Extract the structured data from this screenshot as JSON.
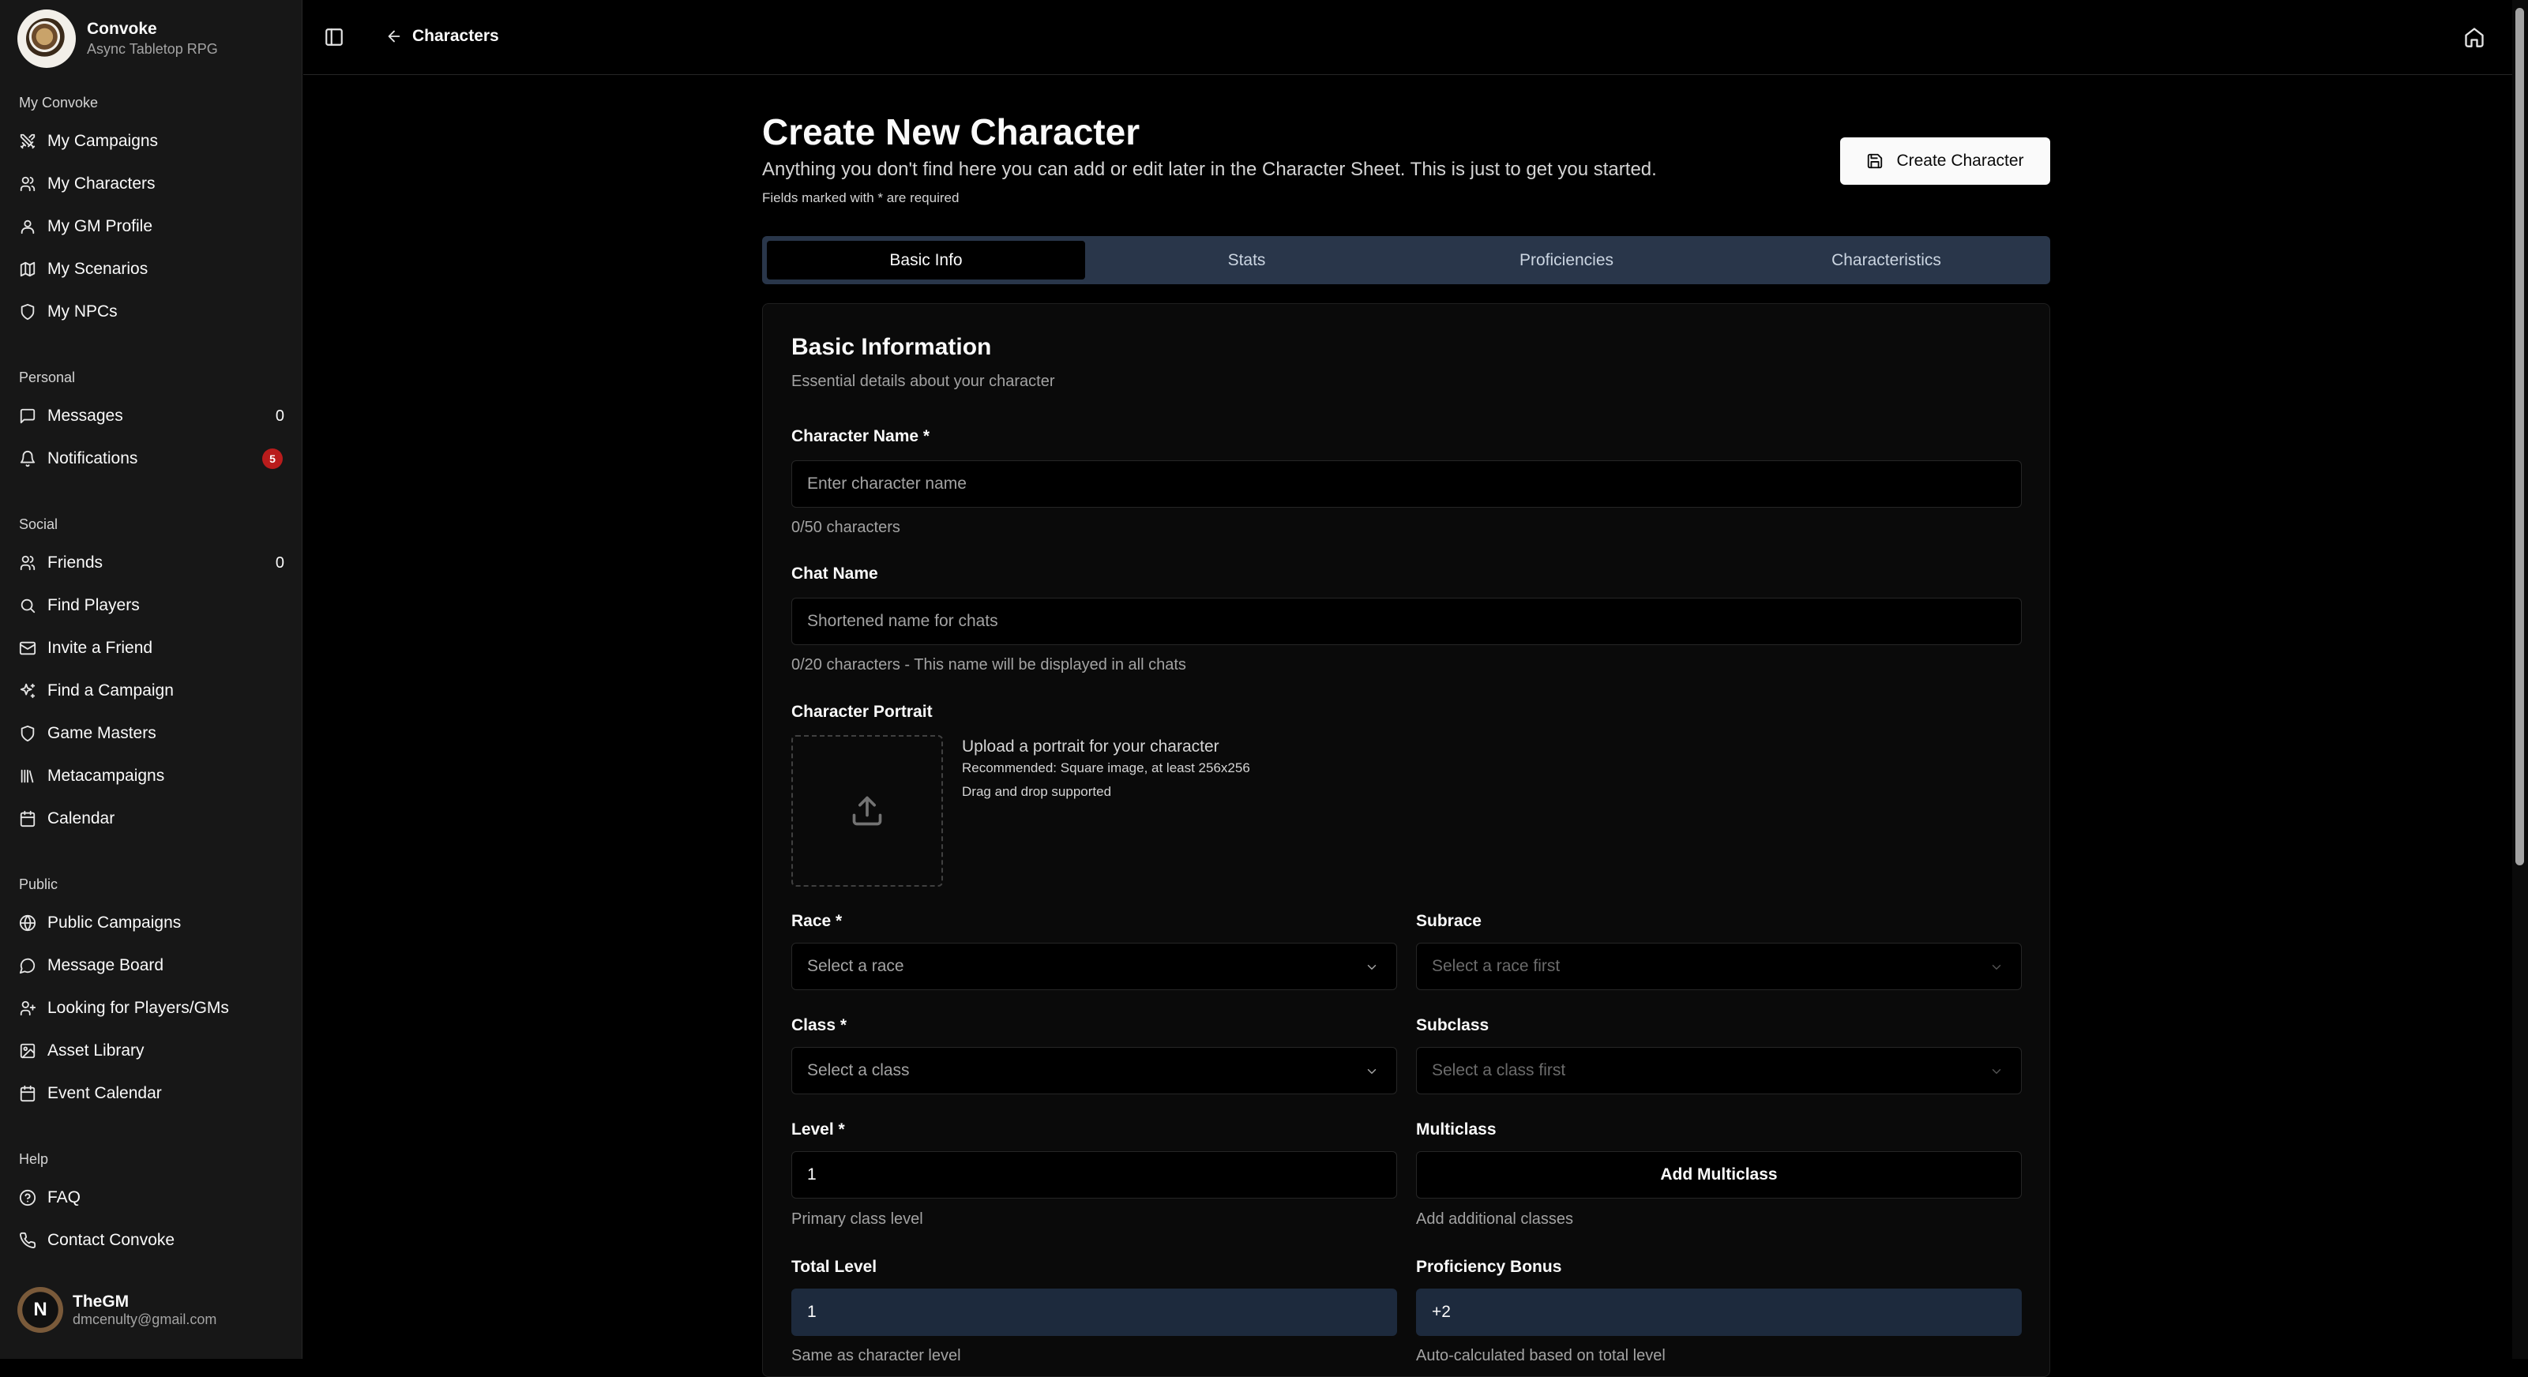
{
  "app": {
    "name": "Convoke",
    "tagline": "Async Tabletop RPG"
  },
  "sidebar": {
    "groups": [
      {
        "label": "My Convoke",
        "items": [
          {
            "label": "My Campaigns",
            "icon": "swords-icon"
          },
          {
            "label": "My Characters",
            "icon": "users-icon"
          },
          {
            "label": "My GM Profile",
            "icon": "user-icon"
          },
          {
            "label": "My Scenarios",
            "icon": "map-icon"
          },
          {
            "label": "My NPCs",
            "icon": "shield-icon"
          }
        ]
      },
      {
        "label": "Personal",
        "items": [
          {
            "label": "Messages",
            "icon": "message-icon",
            "count": "0"
          },
          {
            "label": "Notifications",
            "icon": "bell-icon",
            "badge": "5"
          }
        ]
      },
      {
        "label": "Social",
        "items": [
          {
            "label": "Friends",
            "icon": "users-icon",
            "count": "0"
          },
          {
            "label": "Find Players",
            "icon": "search-icon"
          },
          {
            "label": "Invite a Friend",
            "icon": "mail-icon"
          },
          {
            "label": "Find a Campaign",
            "icon": "sparkles-icon"
          },
          {
            "label": "Game Masters",
            "icon": "shield-icon"
          },
          {
            "label": "Metacampaigns",
            "icon": "library-icon"
          },
          {
            "label": "Calendar",
            "icon": "calendar-icon"
          }
        ]
      },
      {
        "label": "Public",
        "items": [
          {
            "label": "Public Campaigns",
            "icon": "globe-icon"
          },
          {
            "label": "Message Board",
            "icon": "message-icon"
          },
          {
            "label": "Looking for Players/GMs",
            "icon": "user-plus-icon"
          },
          {
            "label": "Asset Library",
            "icon": "image-icon"
          },
          {
            "label": "Event Calendar",
            "icon": "calendar-icon"
          }
        ]
      },
      {
        "label": "Help",
        "items": [
          {
            "label": "FAQ",
            "icon": "help-circle-icon"
          },
          {
            "label": "Contact Convoke",
            "icon": "phone-icon"
          }
        ]
      }
    ],
    "user": {
      "name": "TheGM",
      "email": "dmcenulty@gmail.com",
      "initial": "N"
    }
  },
  "header": {
    "back_label": "Characters"
  },
  "page": {
    "title": "Create New Character",
    "subtitle": "Anything you don't find here you can add or edit later in the Character Sheet. This is just to get you started.",
    "required_note": "Fields marked with * are required",
    "create_button": "Create Character"
  },
  "tabs": [
    {
      "label": "Basic Info",
      "active": true
    },
    {
      "label": "Stats",
      "active": false
    },
    {
      "label": "Proficiencies",
      "active": false
    },
    {
      "label": "Characteristics",
      "active": false
    }
  ],
  "form": {
    "title": "Basic Information",
    "description": "Essential details about your character",
    "character_name": {
      "label": "Character Name *",
      "placeholder": "Enter character name",
      "helper": "0/50 characters"
    },
    "chat_name": {
      "label": "Chat Name",
      "placeholder": "Shortened name for chats",
      "helper": "0/20 characters - This name will be displayed in all chats"
    },
    "portrait": {
      "label": "Character Portrait",
      "title": "Upload a portrait for your character",
      "recommendation": "Recommended: Square image, at least 256x256",
      "drag_note": "Drag and drop supported"
    },
    "race": {
      "label": "Race *",
      "placeholder": "Select a race"
    },
    "subrace": {
      "label": "Subrace",
      "placeholder": "Select a race first"
    },
    "class": {
      "label": "Class *",
      "placeholder": "Select a class"
    },
    "subclass": {
      "label": "Subclass",
      "placeholder": "Select a class first"
    },
    "level": {
      "label": "Level *",
      "value": "1",
      "helper": "Primary class level"
    },
    "multiclass": {
      "label": "Multiclass",
      "button": "Add Multiclass",
      "helper": "Add additional classes"
    },
    "total_level": {
      "label": "Total Level",
      "value": "1",
      "helper": "Same as character level"
    },
    "proficiency_bonus": {
      "label": "Proficiency Bonus",
      "value": "+2",
      "helper": "Auto-calculated based on total level"
    }
  }
}
